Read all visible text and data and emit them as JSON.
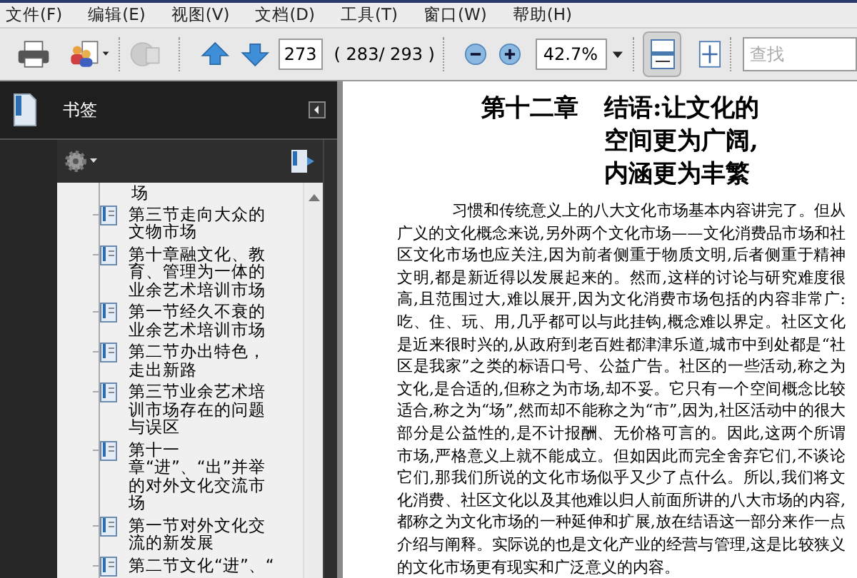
{
  "menu": [
    "文件(F)",
    "编辑(E)",
    "视图(V)",
    "文档(D)",
    "工具(T)",
    "窗口(W)",
    "帮助(H)"
  ],
  "toolbar": {
    "page_number": "273",
    "page_count": "( 283/ 293 )",
    "zoom": "42.7%",
    "fit_width_selected": true,
    "search": {
      "placeholder": "查找"
    }
  },
  "bookmarks": {
    "title": "书签",
    "items": [
      {
        "label": "场"
      },
      {
        "label": "第三节走向大众的文物市场"
      },
      {
        "label": "第十章融文化、教育、管理为一体的业余艺术培训市场"
      },
      {
        "label": "第一节经久不衰的业余艺术培训市场"
      },
      {
        "label": "第二节办出特色，走出新路"
      },
      {
        "label": "第三节业余艺术培训市场存在的问题与误区"
      },
      {
        "label": "第十一章“进”、“出”并举的对外文化交流市场"
      },
      {
        "label": "第一节对外文化交流的新发展"
      },
      {
        "label": "第二节文化“进”、“"
      }
    ]
  },
  "document": {
    "chapter": "第十二章",
    "title_lines": [
      "结语:让文化的",
      "空间更为广阔,",
      "内涵更为丰繁"
    ],
    "paragraph": "习惯和传统意义上的八大文化市场基本内容讲完了。但从广义的文化概念来说,另外两个文化市场——文化消费品市场和社区文化市场也应关注,因为前者侧重于物质文明,后者侧重于精神文明,都是新近得以发展起来的。然而,这样的讨论与研究难度很高,且范围过大,难以展开,因为文化消费市场包括的内容非常广:吃、住、玩、用,几乎都可以与此挂钩,概念难以界定。社区文化是近来很时兴的,从政府到老百姓都津津乐道,城市中到处都是“社区是我家”之类的标语口号、公益广告。社区的一些活动,称之为文化,是合适的,但称之为市场,却不妥。它只有一个空间概念比较适合,称之为“场”,然而却不能称之为“市”,因为,社区活动中的很大部分是公益性的,是不计报酬、无价格可言的。因此,这两个所谓市场,严格意义上就不能成立。但如因此而完全舍弃它们,不谈论它们,那我们所说的文化市场似乎又少了点什么。所以,我们将文化消费、社区文化以及其他难以归人前面所讲的八大市场的内容,都称之为文化市场的一种延伸和扩展,放在结语这一部分来作一点介绍与阐释。实际说的也是文化产业的经营与管理,这是比较狭义的文化市场更有现实和广泛意义的内容。"
  }
}
